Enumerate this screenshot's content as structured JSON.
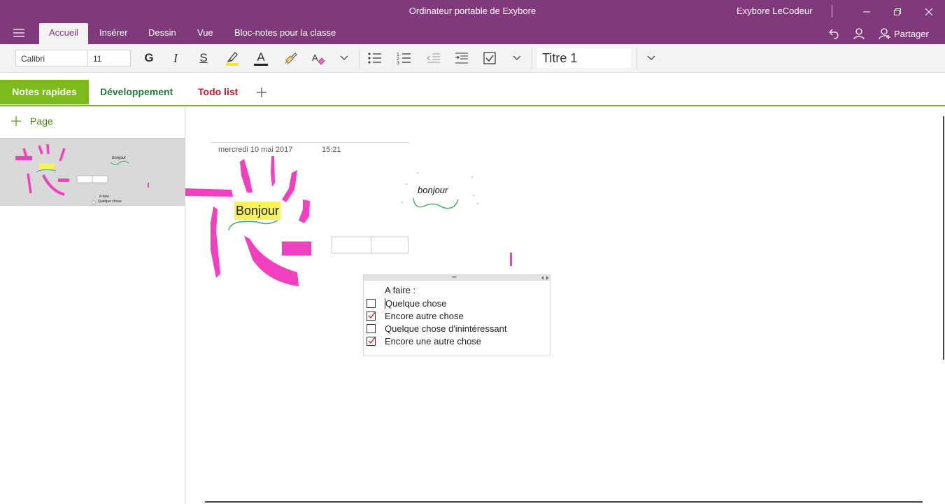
{
  "app": {
    "window_title": "Ordinateur portable de Exybore",
    "user_name": "Exybore LeCodeur"
  },
  "ribbon": {
    "tabs": [
      {
        "label": "Accueil",
        "active": true
      },
      {
        "label": "Insérer"
      },
      {
        "label": "Dessin"
      },
      {
        "label": "Vue"
      },
      {
        "label": "Bloc-notes pour la classe"
      }
    ],
    "share_label": "Partager"
  },
  "toolbar": {
    "font_name": "Calibri",
    "font_size": "11",
    "bold_glyph": "G",
    "italic_glyph": "I",
    "underline_glyph": "S",
    "font_color_glyph": "A",
    "style_value": "Titre 1",
    "colors": {
      "highlight": "#f7e43c",
      "font_color": "#222222"
    }
  },
  "sections": {
    "tabs": [
      {
        "label": "Notes rapides",
        "color": "#7dbb1c",
        "active": true
      },
      {
        "label": "Développement",
        "color": "#1e7d3c"
      },
      {
        "label": "Todo list",
        "color": "#d3142a"
      }
    ],
    "add_icon": "plus-icon"
  },
  "sidebar": {
    "add_page_label": "Page",
    "thumbnail": {
      "title": "Bonjour",
      "todo_header": "A faire :",
      "todo_first": "Quelque chose"
    }
  },
  "page": {
    "date": "mercredi 10 mai 2017",
    "time": "15:21",
    "handwritten_text": "bonjour",
    "highlighted_text": "Bonjour",
    "todo": {
      "header": "A faire :",
      "items": [
        {
          "label": "Quelque chose",
          "checked": false
        },
        {
          "label": "Encore autre chose",
          "checked": true
        },
        {
          "label": "Quelque chose d'inintéressant",
          "checked": false
        },
        {
          "label": "Encore une autre chose",
          "checked": true
        }
      ]
    },
    "colors": {
      "ink_pink": "#f23fbf",
      "ink_green": "#3fae5b",
      "highlight": "#f7f25a",
      "check_red": "#d13438"
    }
  }
}
